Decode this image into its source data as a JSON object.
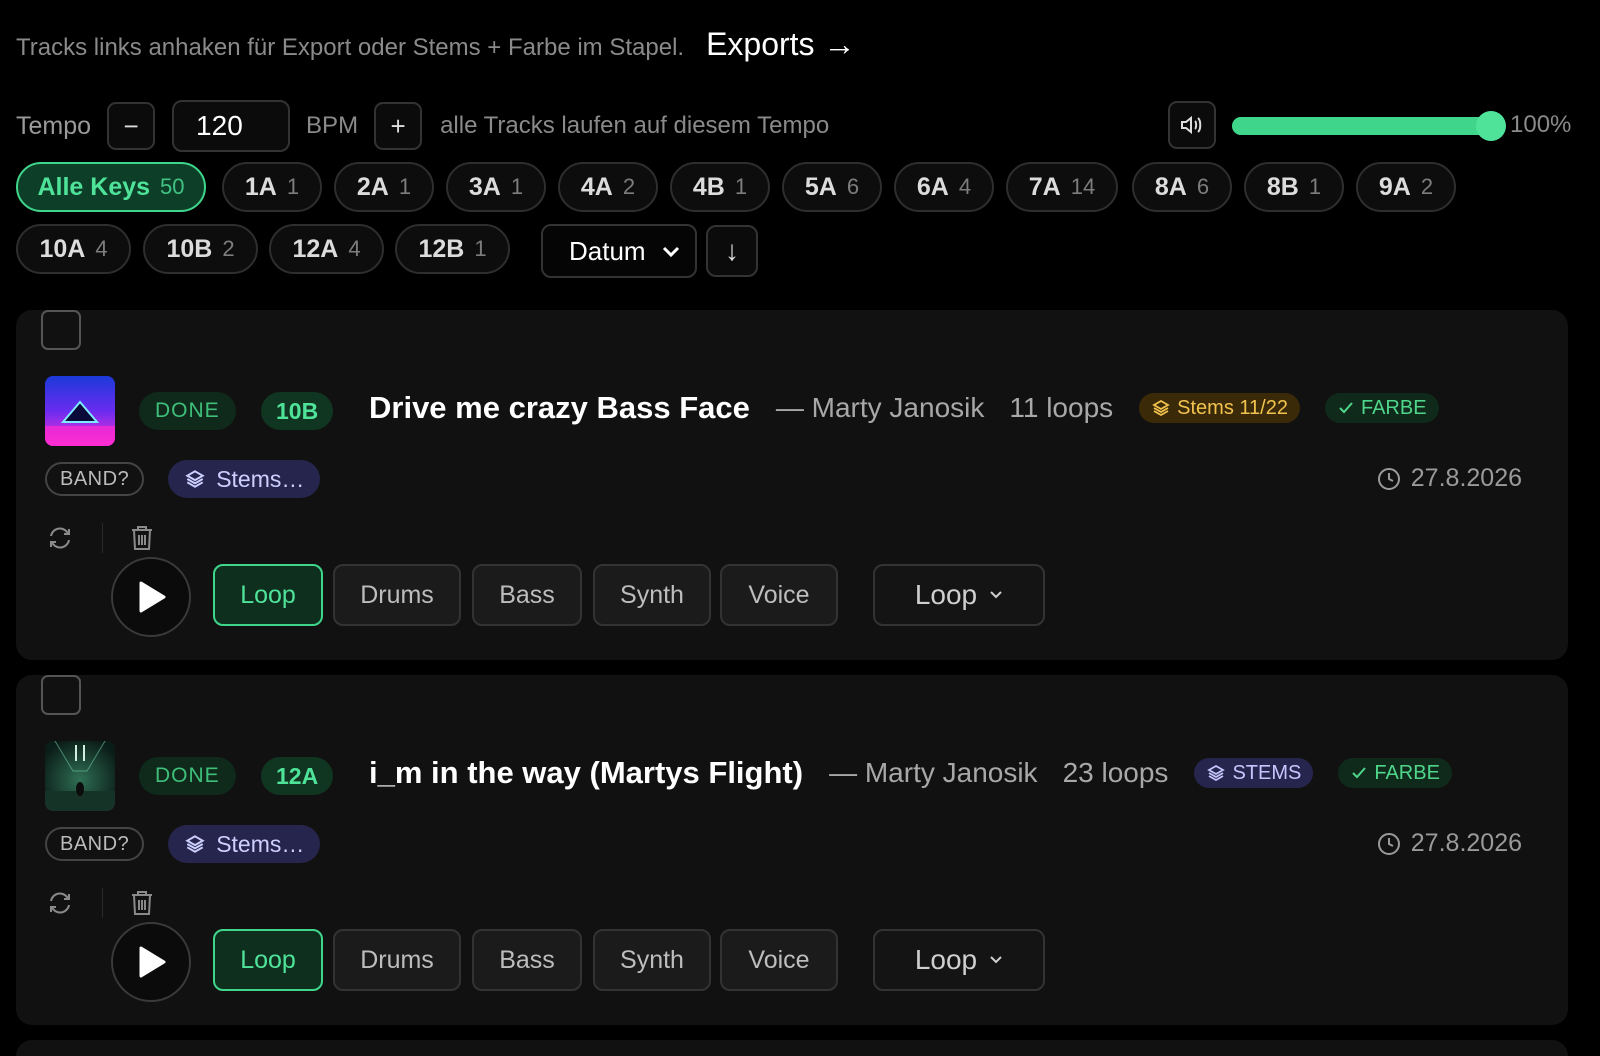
{
  "header": {
    "hint": "Tracks links anhaken für Export oder Stems + Farbe im Stapel.",
    "exports_link": "Exports →"
  },
  "tempo": {
    "label": "Tempo",
    "minus": "−",
    "value": "120",
    "unit": "BPM",
    "plus": "+",
    "note": "alle Tracks laufen auf diesem Tempo",
    "volume_percent": 100,
    "volume_label": "100%"
  },
  "keys": [
    {
      "key": "Alle Keys",
      "count": "50",
      "active": true
    },
    {
      "key": "1A",
      "count": "1"
    },
    {
      "key": "2A",
      "count": "1"
    },
    {
      "key": "3A",
      "count": "1"
    },
    {
      "key": "4A",
      "count": "2"
    },
    {
      "key": "4B",
      "count": "1"
    },
    {
      "key": "5A",
      "count": "6"
    },
    {
      "key": "6A",
      "count": "4"
    },
    {
      "key": "7A",
      "count": "14"
    },
    {
      "key": "8A",
      "count": "6"
    },
    {
      "key": "8B",
      "count": "1"
    },
    {
      "key": "9A",
      "count": "2"
    },
    {
      "key": "10A",
      "count": "4"
    },
    {
      "key": "10B",
      "count": "2"
    },
    {
      "key": "12A",
      "count": "4"
    },
    {
      "key": "12B",
      "count": "1"
    }
  ],
  "sort": {
    "selected": "Datum",
    "direction": "↓"
  },
  "tracks": [
    {
      "status": "DONE",
      "key": "10B",
      "title": "Drive me crazy Bass Face",
      "artist": "— Marty Janosik",
      "loops": "11 loops",
      "stems_badge": "Stems 11/22",
      "farbe_badge": "FARBE",
      "band": "BAND?",
      "stems_button": "Stems…",
      "date": "27.8.2026",
      "segments": [
        "Loop",
        "Drums",
        "Bass",
        "Synth",
        "Voice"
      ],
      "loop_select": "Loop"
    },
    {
      "status": "DONE",
      "key": "12A",
      "title": "i_m in the way (Martys Flight)",
      "artist": "— Marty Janosik",
      "loops": "23 loops",
      "stems_badge": "STEMS",
      "farbe_badge": "FARBE",
      "band": "BAND?",
      "stems_button": "Stems…",
      "date": "27.8.2026",
      "segments": [
        "Loop",
        "Drums",
        "Bass",
        "Synth",
        "Voice"
      ],
      "loop_select": "Loop"
    }
  ],
  "colors": {
    "accent": "#3fd68b",
    "stems_yellow": "#f3c34f",
    "stems_purple": "#c6c6ff"
  }
}
